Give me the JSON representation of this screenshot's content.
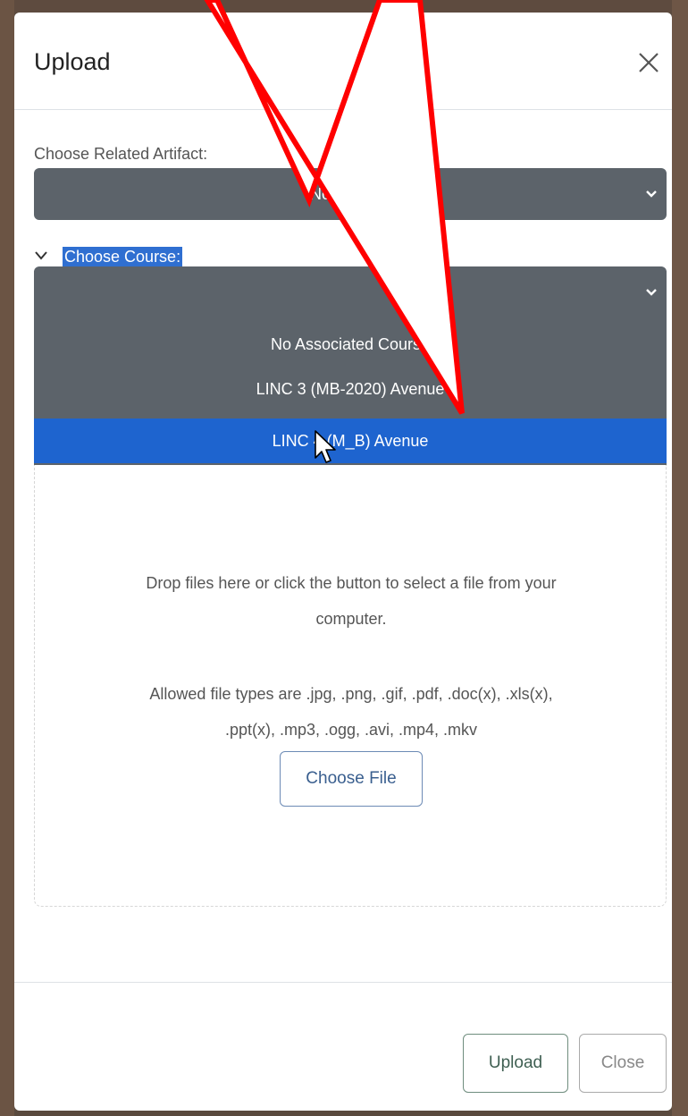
{
  "modal": {
    "title": "Upload"
  },
  "artifact": {
    "label": "Choose Related Artifact:",
    "selected": "No Related"
  },
  "course": {
    "label": "Choose Course:",
    "selected": "",
    "options": [
      {
        "label": "No Associated Course",
        "active": false
      },
      {
        "label": "LINC 3 (MB-2020) Avenue",
        "active": false
      },
      {
        "label": "LINC 4 (M_B) Avenue",
        "active": true
      }
    ]
  },
  "dropzone": {
    "instruction_line1": "Drop files here or click the button to select a file from your",
    "instruction_line2": "computer.",
    "types_line1": "Allowed file types are .jpg, .png, .gif, .pdf, .doc(x), .xls(x),",
    "types_line2": ".ppt(x), .mp3, .ogg, .avi, .mp4, .mkv",
    "choose_file_label": "Choose File"
  },
  "footer": {
    "upload_label": "Upload",
    "close_label": "Close"
  },
  "icons": {
    "close": "close-icon",
    "chevron": "chevron-down-icon",
    "cursor": "mouse-pointer-icon",
    "annotation": "red-pointer-annotation"
  },
  "colors": {
    "select_bg": "#5c636a",
    "active_option": "#1e64cf",
    "annotation_red": "#ff0000"
  }
}
